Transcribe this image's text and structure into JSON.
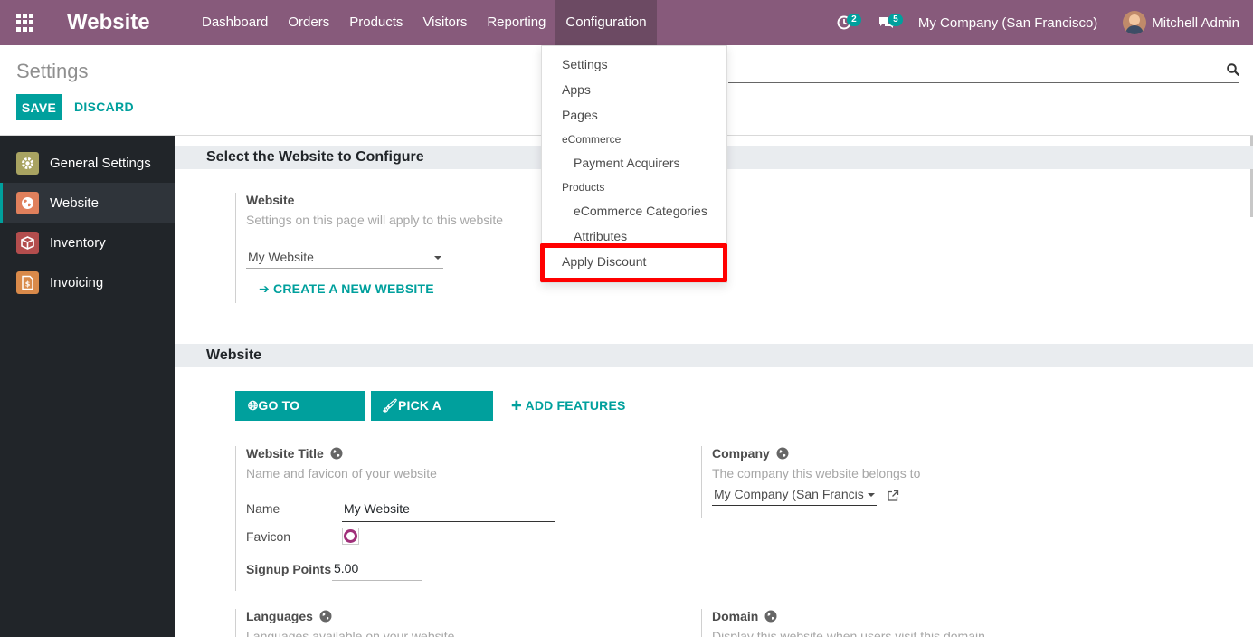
{
  "navbar": {
    "app_title": "Website",
    "menu": [
      "Dashboard",
      "Orders",
      "Products",
      "Visitors",
      "Reporting",
      "Configuration"
    ],
    "activities_count": "2",
    "messages_count": "5",
    "company": "My Company (San Francisco)",
    "user": "Mitchell Admin",
    "bg_color": "#875a7b"
  },
  "control_panel": {
    "breadcrumb": "Settings",
    "save_label": "SAVE",
    "discard_label": "DISCARD",
    "search_placeholder": ""
  },
  "sidebar": {
    "items": [
      {
        "label": "General Settings",
        "icon": "gear-icon",
        "color": "#a8a361"
      },
      {
        "label": "Website",
        "icon": "globe-icon",
        "color": "#e0805c"
      },
      {
        "label": "Inventory",
        "icon": "box-icon",
        "color": "#b34d4d"
      },
      {
        "label": "Invoicing",
        "icon": "invoice-icon",
        "color": "#d98a4a"
      }
    ],
    "active": "Website"
  },
  "content": {
    "section1": {
      "title": "Select the Website to Configure",
      "website_label": "Website",
      "website_help": "Settings on this page will apply to this website",
      "website_value": "My Website",
      "create_link": "CREATE A NEW WEBSITE"
    },
    "section2": {
      "title": "Website",
      "go_to_website": "GO TO WEBSITE",
      "pick_theme": "PICK A THEME",
      "add_features": "ADD FEATURES",
      "title_label": "Website Title",
      "title_help": "Name and favicon of your website",
      "name_label": "Name",
      "name_value": "My Website",
      "favicon_label": "Favicon",
      "signup_label": "Signup Points",
      "signup_value": "5.00",
      "company_label": "Company",
      "company_help": "The company this website belongs to",
      "company_value": "My Company (San Francis",
      "languages_label": "Languages",
      "languages_help": "Languages available on your website",
      "domain_label": "Domain",
      "domain_help": "Display this website when users visit this domain"
    }
  },
  "dropdown": {
    "items": {
      "settings": "Settings",
      "apps": "Apps",
      "pages": "Pages",
      "ecommerce_header": "eCommerce",
      "payment_acquirers": "Payment Acquirers",
      "products_header": "Products",
      "ecommerce_categories": "eCommerce Categories",
      "attributes": "Attributes",
      "apply_discount": "Apply Discount"
    },
    "highlight_color": "#ff0000"
  }
}
